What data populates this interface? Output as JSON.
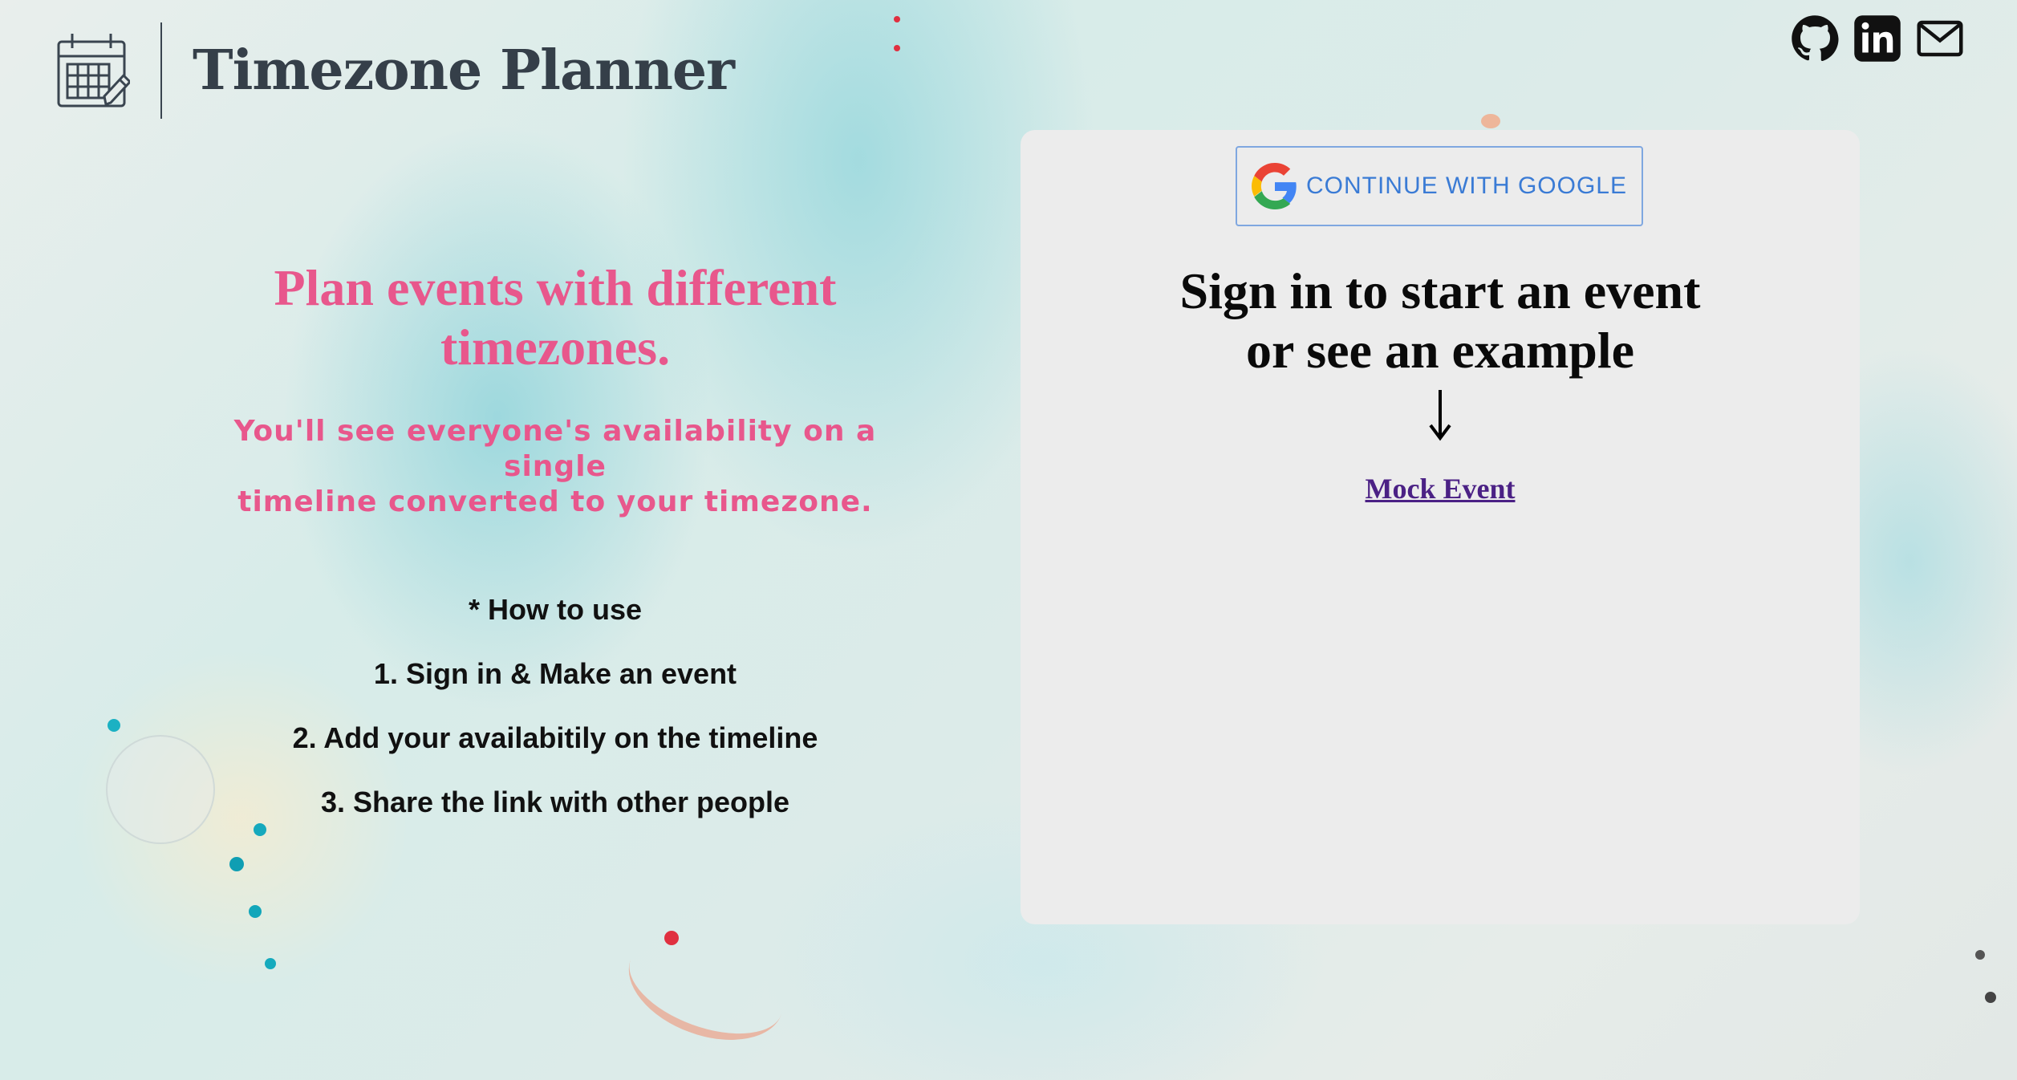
{
  "header": {
    "title": "Timezone Planner",
    "logo_icon": "calendar-edit-icon"
  },
  "social": [
    {
      "name": "github-icon"
    },
    {
      "name": "linkedin-icon"
    },
    {
      "name": "mail-icon"
    }
  ],
  "hero": {
    "title_line1": "Plan events with different",
    "title_line2": "timezones.",
    "subtitle_line1": "You'll see everyone's availability on a single",
    "subtitle_line2": "timeline converted to your timezone."
  },
  "howto": {
    "heading": "* How to use",
    "steps": [
      "1. Sign in & Make an event",
      "2. Add your availabitily on the timeline",
      "3. Share the link with other people"
    ]
  },
  "card": {
    "google_button_label": "CONTINUE WITH GOOGLE",
    "heading_line1": "Sign in to start an event",
    "heading_line2": "or see an example",
    "arrow_icon": "arrow-down-icon",
    "mock_link_label": "Mock Event"
  },
  "colors": {
    "accent_pink": "#e8578c",
    "title_dark": "#353f49",
    "link_purple": "#4b2185",
    "google_blue": "#3a7bd5",
    "card_bg": "#ececec"
  }
}
